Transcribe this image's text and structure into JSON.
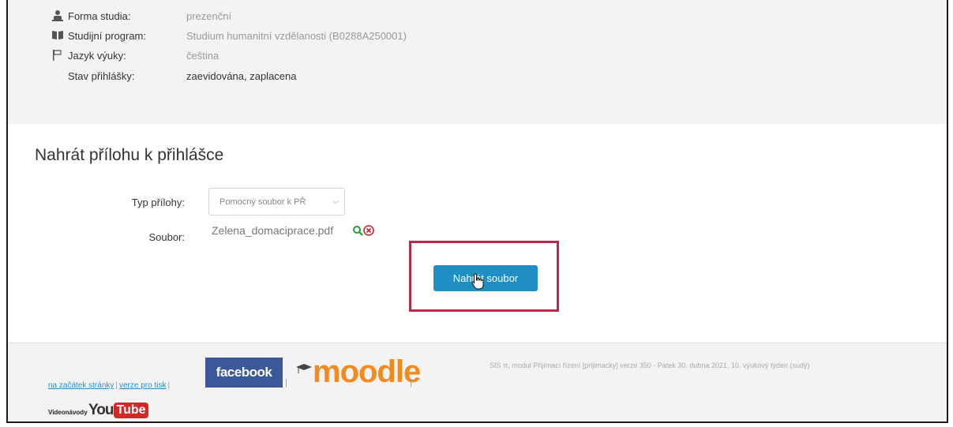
{
  "info": {
    "rows": [
      {
        "icon": "person-icon",
        "label": "Forma studia:",
        "value": "prezenční"
      },
      {
        "icon": "book-icon",
        "label": "Studijní program:",
        "value": "Studium humanitní vzdělanosti (B0288A250001)"
      },
      {
        "icon": "flag-icon",
        "label": "Jazyk výuky:",
        "value": "čeština"
      },
      {
        "icon": "",
        "label": "Stav přihlášky:",
        "value": "zaevidována, zaplacena"
      }
    ]
  },
  "upload": {
    "title": "Nahrát přílohu k přihlášce",
    "type_label": "Typ přílohy:",
    "type_selected": "Pomocný soubor k PŘ",
    "file_label": "Soubor:",
    "file_name": "Zelena_domaciprace.pdf",
    "button_label": "Nahrát soubor"
  },
  "footer": {
    "link_top": "na začátek stránky",
    "link_print": "verze pro tisk",
    "separator": "|",
    "facebook": "facebook",
    "moodle": "moodle",
    "info": "SIS π, modul Přijímací řízení [prijimacky] verze 350 - Pátek 30. dubna 2021, 10. výukový týden (sudý)",
    "video_label": "Videonávody",
    "youtube_you": "You",
    "youtube_tube": "Tube"
  },
  "colors": {
    "accent": "#1f8fc3",
    "highlight": "#b32a4b",
    "facebook": "#3b5998",
    "moodle": "#f28a1d",
    "youtube": "#d12828"
  }
}
